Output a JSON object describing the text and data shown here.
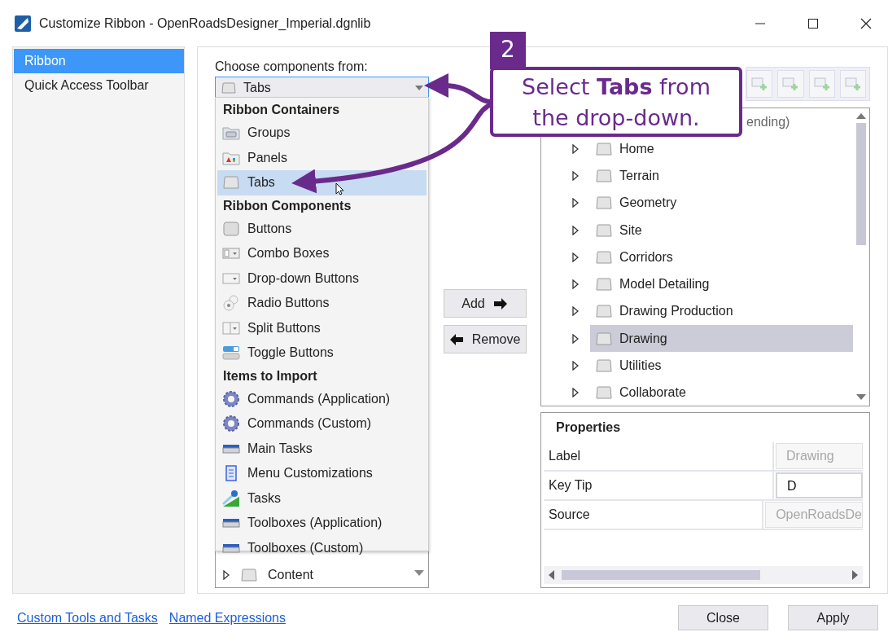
{
  "window": {
    "title": "Customize Ribbon - OpenRoadsDesigner_Imperial.dgnlib"
  },
  "sidebar": {
    "items": [
      {
        "label": "Ribbon",
        "selected": true
      },
      {
        "label": "Quick Access Toolbar",
        "selected": false
      }
    ]
  },
  "components": {
    "label": "Choose components from:",
    "value": "Tabs",
    "dropdown": [
      {
        "kind": "header",
        "label": "Ribbon Containers"
      },
      {
        "kind": "groups",
        "label": "Groups",
        "selected": false
      },
      {
        "kind": "panels",
        "label": "Panels",
        "selected": false
      },
      {
        "kind": "tab",
        "label": "Tabs",
        "selected": true
      },
      {
        "kind": "header",
        "label": "Ribbon Components"
      },
      {
        "kind": "button",
        "label": "Buttons",
        "selected": false
      },
      {
        "kind": "combo",
        "label": "Combo Boxes",
        "selected": false
      },
      {
        "kind": "dropdown",
        "label": "Drop-down Buttons",
        "selected": false
      },
      {
        "kind": "radio",
        "label": "Radio Buttons",
        "selected": false
      },
      {
        "kind": "split",
        "label": "Split Buttons",
        "selected": false
      },
      {
        "kind": "toggle",
        "label": "Toggle Buttons",
        "selected": false
      },
      {
        "kind": "header",
        "label": "Items to Import"
      },
      {
        "kind": "command",
        "label": "Commands (Application)",
        "selected": false
      },
      {
        "kind": "command",
        "label": "Commands (Custom)",
        "selected": false
      },
      {
        "kind": "toolbox",
        "label": "Main Tasks",
        "selected": false
      },
      {
        "kind": "menu",
        "label": "Menu Customizations",
        "selected": false
      },
      {
        "kind": "tasks",
        "label": "Tasks",
        "selected": false
      },
      {
        "kind": "toolbox",
        "label": "Toolboxes (Application)",
        "selected": false
      },
      {
        "kind": "toolbox",
        "label": "Toolboxes (Custom)",
        "selected": false
      }
    ],
    "tree": [
      {
        "label": "Content",
        "expanded": false
      }
    ]
  },
  "buttons": {
    "add": "Add",
    "remove": "Remove"
  },
  "ribbon_tree": {
    "root": "ending)",
    "items": [
      {
        "label": "Home",
        "expanded": false,
        "selected": false
      },
      {
        "label": "Terrain",
        "expanded": false,
        "selected": false
      },
      {
        "label": "Geometry",
        "expanded": false,
        "selected": false
      },
      {
        "label": "Site",
        "expanded": false,
        "selected": false
      },
      {
        "label": "Corridors",
        "expanded": false,
        "selected": false
      },
      {
        "label": "Model Detailing",
        "expanded": false,
        "selected": false
      },
      {
        "label": "Drawing Production",
        "expanded": false,
        "selected": false
      },
      {
        "label": "Drawing",
        "expanded": false,
        "selected": true
      },
      {
        "label": "Utilities",
        "expanded": false,
        "selected": false
      },
      {
        "label": "Collaborate",
        "expanded": false,
        "selected": false
      }
    ]
  },
  "properties": {
    "title": "Properties",
    "rows": [
      {
        "label": "Label",
        "value": "Drawing",
        "disabled": true
      },
      {
        "label": "Key Tip",
        "value": "D",
        "disabled": false
      },
      {
        "label": "Source",
        "value": "OpenRoadsDe",
        "disabled": true
      }
    ]
  },
  "footer": {
    "links": [
      "Custom Tools and Tasks",
      "Named Expressions"
    ],
    "buttons": [
      "Close",
      "Apply"
    ]
  },
  "callout": {
    "step": "2",
    "text": "Select **Tabs** from the drop-down."
  }
}
